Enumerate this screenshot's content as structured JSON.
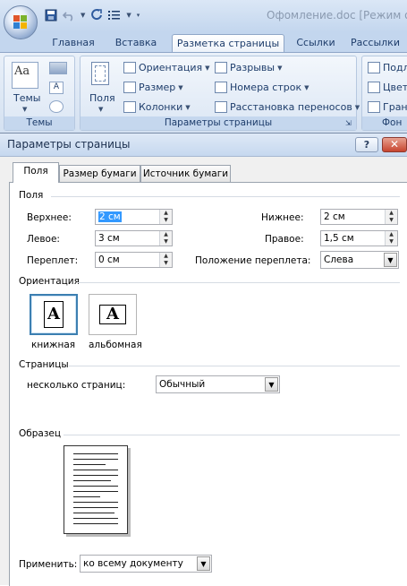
{
  "window": {
    "doc_title": "Офомление.doc [Режим огр"
  },
  "ribbon_tabs": [
    "Главная",
    "Вставка",
    "Разметка страницы",
    "Ссылки",
    "Рассылки"
  ],
  "ribbon": {
    "themes": {
      "button": "Темы",
      "group": "Темы"
    },
    "page_setup": {
      "group": "Параметры страницы",
      "fields_button": "Поля",
      "orientation": "Ориентация",
      "size": "Размер",
      "columns": "Колонки",
      "breaks": "Разрывы",
      "line_numbers": "Номера строк",
      "hyphenation": "Расстановка переносов"
    },
    "background": {
      "group": "Фон",
      "items": [
        "Подл",
        "Цвет",
        "Гран"
      ]
    }
  },
  "dialog": {
    "title": "Параметры страницы",
    "help_label": "?",
    "close_label": "✕",
    "tabs": [
      "Поля",
      "Размер бумаги",
      "Источник бумаги"
    ],
    "margins": {
      "section": "Поля",
      "top_label": "Верхнее:",
      "top_value": "2 см",
      "bottom_label": "Нижнее:",
      "bottom_value": "2 см",
      "left_label": "Левое:",
      "left_value": "3 см",
      "right_label": "Правое:",
      "right_value": "1,5 см",
      "gutter_label": "Переплет:",
      "gutter_value": "0 см",
      "gutter_pos_label": "Положение переплета:",
      "gutter_pos_value": "Слева"
    },
    "orientation": {
      "section": "Ориентация",
      "portrait": "книжная",
      "landscape": "альбомная",
      "glyph": "A",
      "selected": "portrait"
    },
    "pages": {
      "section": "Страницы",
      "multiple_label": "несколько страниц:",
      "multiple_value": "Обычный"
    },
    "preview": {
      "section": "Образец"
    },
    "apply": {
      "label": "Применить:",
      "value": "ко всему документу"
    }
  }
}
